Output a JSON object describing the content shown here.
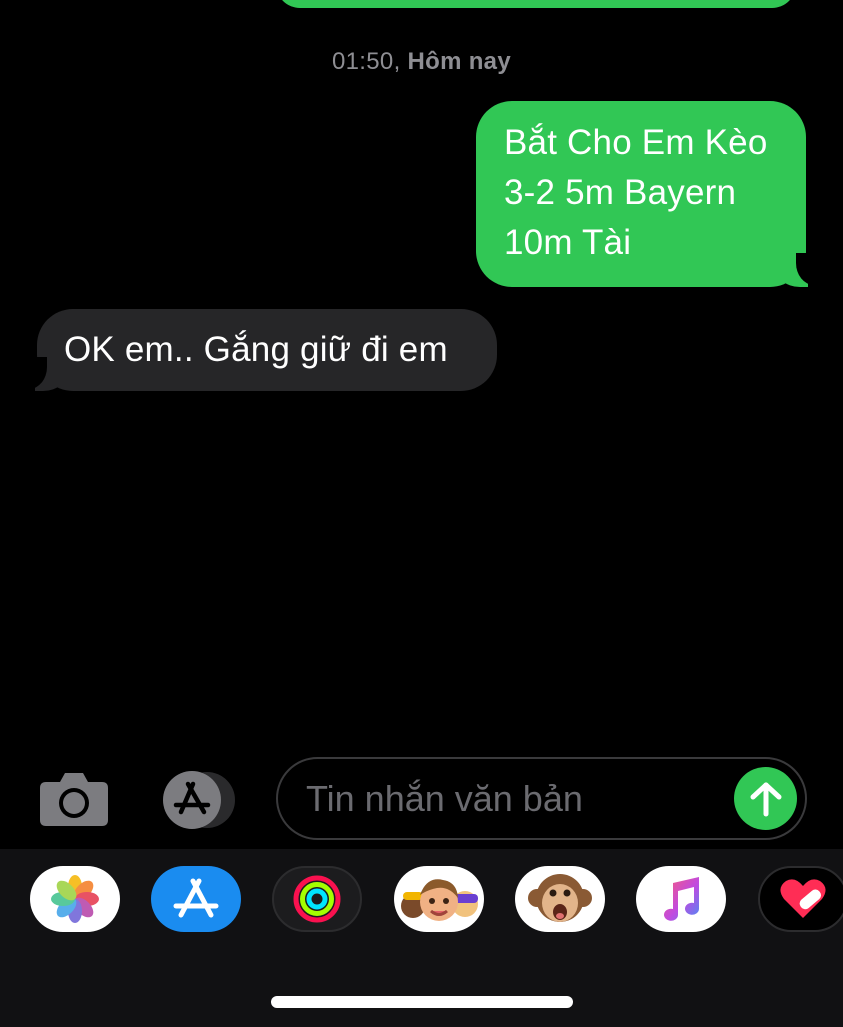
{
  "thread": {
    "timestamp_time": "01:50,",
    "timestamp_day": "Hôm nay",
    "messages": [
      {
        "direction": "outgoing",
        "lines": [
          "Bắt Cho Em Kèo",
          "3-2 5m Bayern",
          "10m Tài"
        ]
      },
      {
        "direction": "incoming",
        "text": "OK em.. Gắng giữ đi em"
      }
    ]
  },
  "composer": {
    "placeholder": "Tin nhắn văn bản",
    "value": ""
  },
  "app_drawer": {
    "apps": [
      {
        "icon": "photos-icon",
        "bg": "#ffffff"
      },
      {
        "icon": "app-store-icon",
        "bg": "#1a8cf0"
      },
      {
        "icon": "activity-icon",
        "bg": "#1c1c1e"
      },
      {
        "icon": "memoji-stickers-icon",
        "bg": "#ffffff"
      },
      {
        "icon": "animoji-monkey-icon",
        "bg": "#ffffff"
      },
      {
        "icon": "music-icon",
        "bg": "#ffffff"
      },
      {
        "icon": "digital-touch-icon",
        "bg": "#000000"
      }
    ]
  },
  "colors": {
    "outgoing_bubble": "#31c755",
    "incoming_bubble": "#262628",
    "background": "#000000",
    "timestamp": "#8e8e93",
    "send_button": "#31c755"
  }
}
